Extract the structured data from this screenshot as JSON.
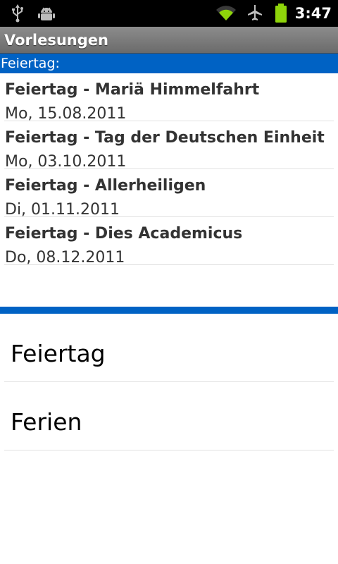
{
  "status_bar": {
    "time": "3:47",
    "icons": [
      "usb-icon",
      "android-debug-icon",
      "wifi-icon",
      "airplane-icon",
      "battery-icon"
    ],
    "battery_color": "#8ed40a",
    "wifi_color": "#8ed40a"
  },
  "app": {
    "title": "Vorlesungen"
  },
  "section": {
    "header": "Feiertag:",
    "accent_color": "#0062c4"
  },
  "events": [
    {
      "title": "Feiertag - Mariä Himmelfahrt",
      "date": "Mo, 15.08.2011"
    },
    {
      "title": "Feiertag - Tag der Deutschen Einheit",
      "date": "Mo, 03.10.2011"
    },
    {
      "title": "Feiertag - Allerheiligen",
      "date": "Di, 01.11.2011"
    },
    {
      "title": "Feiertag - Dies Academicus",
      "date": "Do, 08.12.2011"
    }
  ],
  "categories": [
    {
      "label": "Feiertag"
    },
    {
      "label": "Ferien"
    }
  ]
}
